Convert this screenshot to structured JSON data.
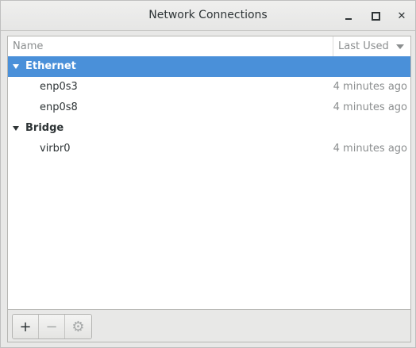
{
  "window": {
    "title": "Network Connections",
    "controls": {
      "minimize_icon": "minimize-icon",
      "maximize_icon": "maximize-icon",
      "close_glyph": "✕"
    }
  },
  "list": {
    "columns": {
      "name": "Name",
      "last_used": "Last Used"
    },
    "groups": [
      {
        "label": "Ethernet",
        "selected": true,
        "items": [
          {
            "name": "enp0s3",
            "last_used": "4 minutes ago"
          },
          {
            "name": "enp0s8",
            "last_used": "4 minutes ago"
          }
        ]
      },
      {
        "label": "Bridge",
        "selected": false,
        "items": [
          {
            "name": "virbr0",
            "last_used": "4 minutes ago"
          }
        ]
      }
    ]
  },
  "toolbar": {
    "add_glyph": "+",
    "remove_glyph": "−",
    "settings_glyph": "⚙"
  },
  "colors": {
    "selection": "#4a90d9",
    "background": "#e8e8e7",
    "muted_text": "#8b8e8f"
  }
}
